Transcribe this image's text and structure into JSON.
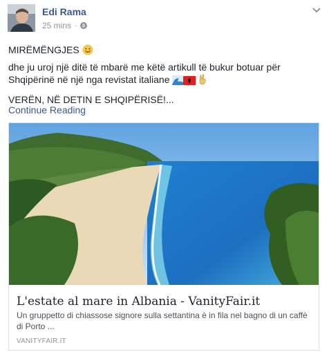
{
  "post": {
    "author": "Edi Rama",
    "time": "25 mins",
    "separator": "·",
    "line1": "MIRËMËNGJES",
    "line2": "dhe ju uroj një ditë të mbarë me këtë artikull të bukur botuar për Shqipërinë në një nga revistat italiane",
    "line3": "VERËN, NË DETIN E SHQIPËRISË!...",
    "continue": "Continue Reading"
  },
  "link_card": {
    "title": "L'estate al mare in Albania - VanityFair.it",
    "description": "Un gruppetto di chiassose signore sulla settantina è in fila nel bagno di un caffè di Porto ...",
    "source": "VANITYFAIR.IT"
  },
  "icons": {
    "audience": "globe-icon",
    "menu": "chevron-down-icon",
    "smile": "smiling-face-emoji",
    "wave": "wave-emoji",
    "flag": "albania-flag-emoji",
    "victory": "victory-hand-emoji"
  },
  "colors": {
    "link": "#365899",
    "text": "#1d2129",
    "muted": "#90949c"
  }
}
